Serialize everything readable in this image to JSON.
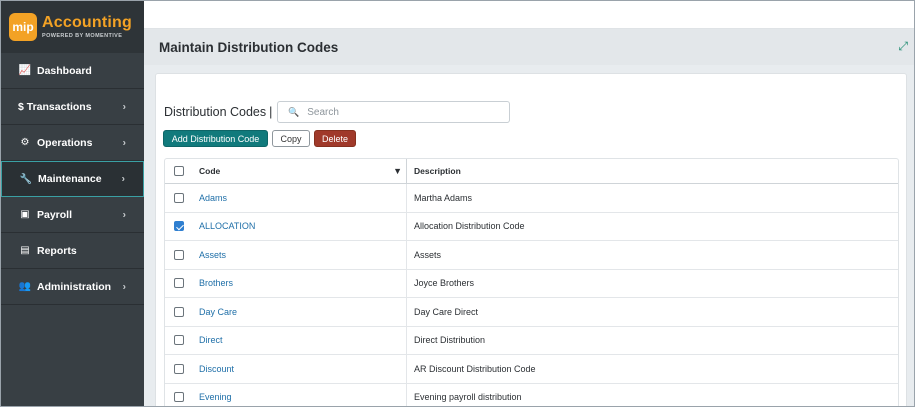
{
  "logo": {
    "badge": "mip",
    "title": "Accounting",
    "subtitle": "POWERED BY MOMENTIVE"
  },
  "nav": [
    {
      "label": "Dashboard",
      "icon": "chart-line-icon",
      "glyph": "📈",
      "chevron": false,
      "active": false
    },
    {
      "label": "$ Transactions",
      "icon": "",
      "glyph": "",
      "chevron": true,
      "active": false
    },
    {
      "label": "Operations",
      "icon": "gears-icon",
      "glyph": "⚙",
      "chevron": true,
      "active": false
    },
    {
      "label": "Maintenance",
      "icon": "wrench-icon",
      "glyph": "🔧",
      "chevron": true,
      "active": true
    },
    {
      "label": "Payroll",
      "icon": "money-icon",
      "glyph": "▣",
      "chevron": true,
      "active": false
    },
    {
      "label": "Reports",
      "icon": "report-icon",
      "glyph": "▤",
      "chevron": false,
      "active": false
    },
    {
      "label": "Administration",
      "icon": "users-icon",
      "glyph": "👥",
      "chevron": true,
      "active": false
    }
  ],
  "page": {
    "title": "Maintain Distribution Codes"
  },
  "toolbar": {
    "section_label": "Distribution Codes",
    "separator": "|",
    "search_placeholder": "Search",
    "add_label": "Add Distribution Code",
    "copy_label": "Copy",
    "delete_label": "Delete"
  },
  "table": {
    "columns": {
      "code": "Code",
      "description": "Description"
    },
    "rows": [
      {
        "code": "Adams",
        "description": "Martha Adams",
        "checked": false
      },
      {
        "code": "ALLOCATION",
        "description": "Allocation Distribution Code",
        "checked": true
      },
      {
        "code": "Assets",
        "description": "Assets",
        "checked": false
      },
      {
        "code": "Brothers",
        "description": "Joyce Brothers",
        "checked": false
      },
      {
        "code": "Day Care",
        "description": "Day Care Direct",
        "checked": false
      },
      {
        "code": "Direct",
        "description": "Direct Distribution",
        "checked": false
      },
      {
        "code": "Discount",
        "description": "AR Discount Distribution Code",
        "checked": false
      },
      {
        "code": "Evening",
        "description": "Evening payroll distribution",
        "checked": false
      }
    ]
  },
  "colors": {
    "brand_orange": "#f3a225",
    "teal": "#117a7c",
    "delete_red": "#a0392a",
    "link_blue": "#1f6fa8",
    "check_blue": "#2f7fd0"
  }
}
